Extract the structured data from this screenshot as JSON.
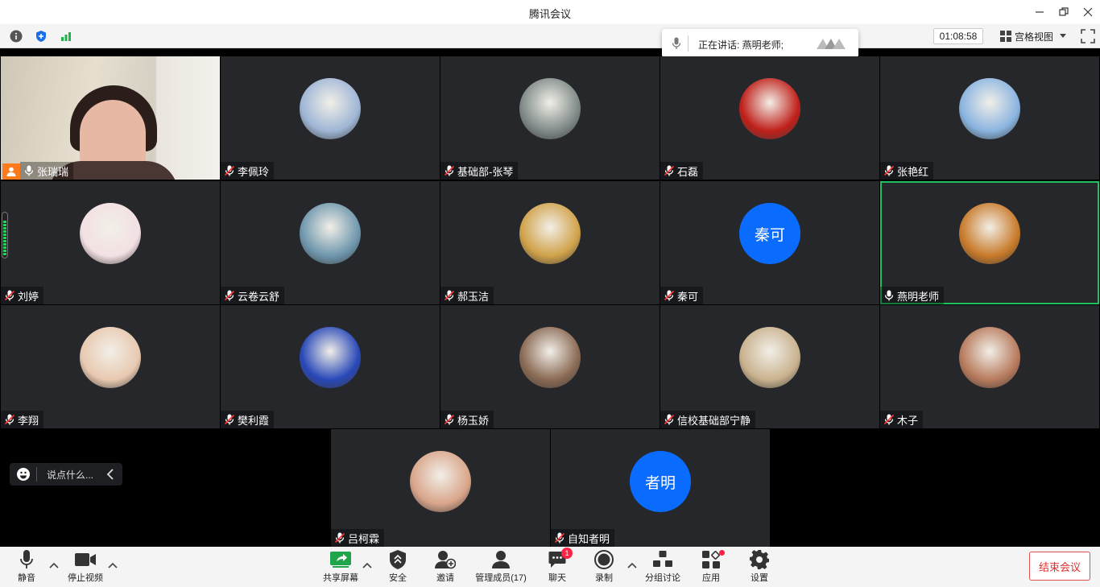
{
  "window": {
    "title": "腾讯会议"
  },
  "topbar": {
    "timer": "01:08:58",
    "view_label": "宫格视图"
  },
  "speaking": {
    "label": "正在讲话: 燕明老师;"
  },
  "participants": [
    {
      "name": "张瑞瑞",
      "mic": "on",
      "video": true,
      "host": true
    },
    {
      "name": "李佩玲",
      "mic": "muted",
      "avatar_color": "#9fb6d6"
    },
    {
      "name": "基础部-张琴",
      "mic": "muted",
      "avatar_color": "#7f8a88"
    },
    {
      "name": "石磊",
      "mic": "muted",
      "avatar_color": "#c0201a"
    },
    {
      "name": "张艳红",
      "mic": "muted",
      "avatar_color": "#8ab4e0"
    },
    {
      "name": "刘婷",
      "mic": "muted",
      "avatar_color": "#f3e0e3"
    },
    {
      "name": "云卷云舒",
      "mic": "muted",
      "avatar_color": "#6f97ad"
    },
    {
      "name": "郝玉洁",
      "mic": "muted",
      "avatar_color": "#d0a24a"
    },
    {
      "name": "秦可",
      "mic": "muted",
      "avatar_text": "秦可"
    },
    {
      "name": "燕明老师",
      "mic": "on",
      "avatar_color": "#c87a2a",
      "active": true
    },
    {
      "name": "李翔",
      "mic": "muted",
      "avatar_color": "#e8c9b0"
    },
    {
      "name": "樊利霞",
      "mic": "muted",
      "avatar_color": "#2848b8"
    },
    {
      "name": "杨玉娇",
      "mic": "muted",
      "avatar_color": "#8a6a54"
    },
    {
      "name": "信校基础部宁静",
      "mic": "muted",
      "avatar_color": "#c9b28e"
    },
    {
      "name": "木子",
      "mic": "muted",
      "avatar_color": "#b77a5c"
    },
    {
      "name": "吕柯霖",
      "mic": "muted",
      "avatar_color": "#d9a58a"
    },
    {
      "name": "自知者明",
      "mic": "muted",
      "avatar_text": "者明"
    }
  ],
  "chat": {
    "placeholder": "说点什么..."
  },
  "toolbar": {
    "mute": "静音",
    "stop_video": "停止视频",
    "share": "共享屏幕",
    "security": "安全",
    "invite": "邀请",
    "members": "管理成员(17)",
    "chat": "聊天",
    "chat_badge": "1",
    "record": "录制",
    "breakout": "分组讨论",
    "apps": "应用",
    "settings": "设置",
    "end": "结束会议"
  },
  "colors": {
    "accent": "#0a6cff",
    "active_border": "#20c05c",
    "end": "#e03030"
  }
}
